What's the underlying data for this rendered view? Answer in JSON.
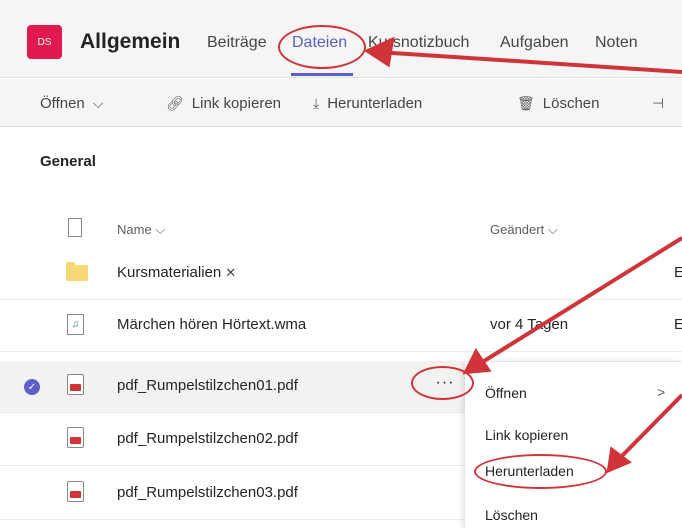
{
  "team": {
    "avatar_text": "DS",
    "channel": "Allgemein"
  },
  "tabs": [
    "Beiträge",
    "Dateien",
    "Kursnotizbuch",
    "Aufgaben",
    "Noten"
  ],
  "toolbar": {
    "open": "Öffnen",
    "copy_link": "Link kopieren",
    "download": "Herunterladen",
    "delete": "Löschen"
  },
  "section_title": "General",
  "columns": {
    "name": "Name",
    "modified": "Geändert"
  },
  "rows": [
    {
      "name": "Kursmaterialien",
      "modified": "",
      "extra": "E",
      "type": "folder"
    },
    {
      "name": "Märchen hören Hörtext.wma",
      "modified": "vor 4 Tagen",
      "extra": "E",
      "type": "audio"
    },
    {
      "name": "pdf_Rumpelstilzchen01.pdf",
      "modified": "",
      "extra": "",
      "type": "pdf",
      "selected": true
    },
    {
      "name": "pdf_Rumpelstilzchen02.pdf",
      "modified": "",
      "extra": "",
      "type": "pdf"
    },
    {
      "name": "pdf_Rumpelstilzchen03.pdf",
      "modified": "",
      "extra": "",
      "type": "pdf"
    }
  ],
  "more_label": "···",
  "context_menu": [
    "Öffnen",
    "Link kopieren",
    "Herunterladen",
    "Löschen"
  ],
  "colors": {
    "accent": "#5b5fc7",
    "avatar": "#e0194f",
    "annotation": "#d13438"
  }
}
